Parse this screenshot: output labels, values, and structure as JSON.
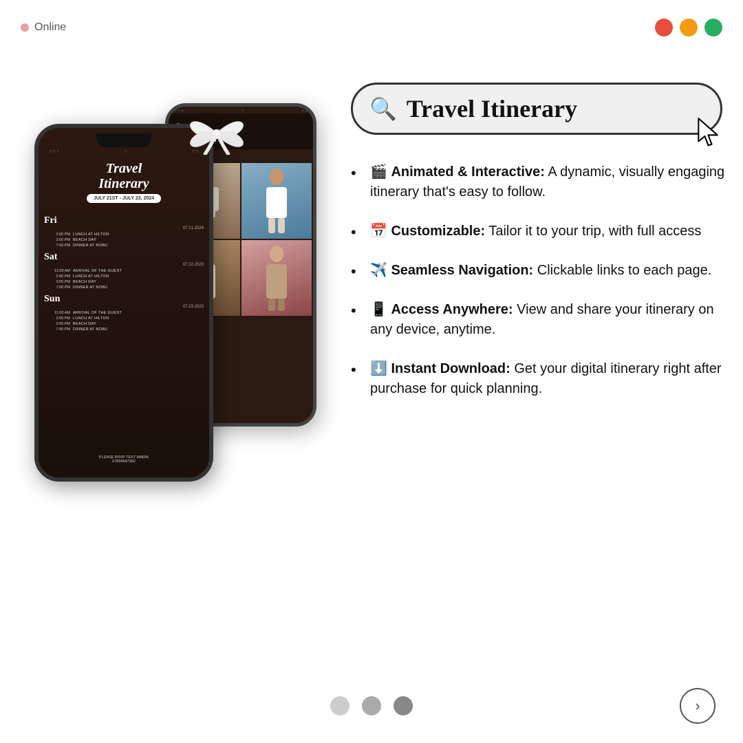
{
  "topbar": {
    "online_label": "Online",
    "traffic_lights": [
      "red",
      "yellow",
      "green"
    ]
  },
  "search": {
    "icon": "🔍",
    "text": "Travel Itinerary"
  },
  "features": [
    {
      "emoji": "🎬",
      "bold": "Animated & Interactive:",
      "text": " A dynamic, visually engaging itinerary that's easy to follow."
    },
    {
      "emoji": "📅",
      "bold": "Customizable:",
      "text": " Tailor it to your trip, with full access"
    },
    {
      "emoji": "✈️",
      "bold": "Seamless Navigation:",
      "text": " Clickable links to each page."
    },
    {
      "emoji": "📱",
      "bold": "Access Anywhere:",
      "text": " View and share your itinerary on any device, anytime."
    },
    {
      "emoji": "⬇️",
      "bold": "Instant Download:",
      "text": " Get your digital itinerary right after purchase for quick planning."
    }
  ],
  "phone_main": {
    "title": "Travel\nItinerary",
    "dates": "JULY 21ST - JULY 23, 2024",
    "days": [
      {
        "label": "Fri",
        "date": "07.21.2024",
        "events": [
          {
            "time": "2:00 PM",
            "name": "LUNCH AT HILTON"
          },
          {
            "time": "3:00 PM",
            "name": "BEACH DAY"
          },
          {
            "time": "7:00 PM",
            "name": "DINNER AT NOBU"
          }
        ]
      },
      {
        "label": "Sat",
        "date": "07.22.2023",
        "events": [
          {
            "time": "11:00 AM",
            "name": "ARRIVAL OF THE GUEST"
          },
          {
            "time": "2:00 PM",
            "name": "LUNCH AT HILTON"
          },
          {
            "time": "3:00 PM",
            "name": "BEACH DAY"
          },
          {
            "time": "7:00 PM",
            "name": "DINNER AT NOBU"
          }
        ]
      },
      {
        "label": "Sun",
        "date": "07.23.2023",
        "events": [
          {
            "time": "11:00 AM",
            "name": "ARRIVAL OF THE GUEST"
          },
          {
            "time": "2:00 PM",
            "name": "LUNCH AT HILTON"
          },
          {
            "time": "3:00 PM",
            "name": "BEACH DAY"
          },
          {
            "time": "7:00 PM",
            "name": "DINNER AT NOBU"
          }
        ]
      }
    ],
    "rsvp": "PLEASE RSVP TEXT MARIA\n07894547362"
  },
  "phone_back": {
    "title": "Outfit\nMoodboard"
  },
  "bottom": {
    "next_label": "›"
  }
}
